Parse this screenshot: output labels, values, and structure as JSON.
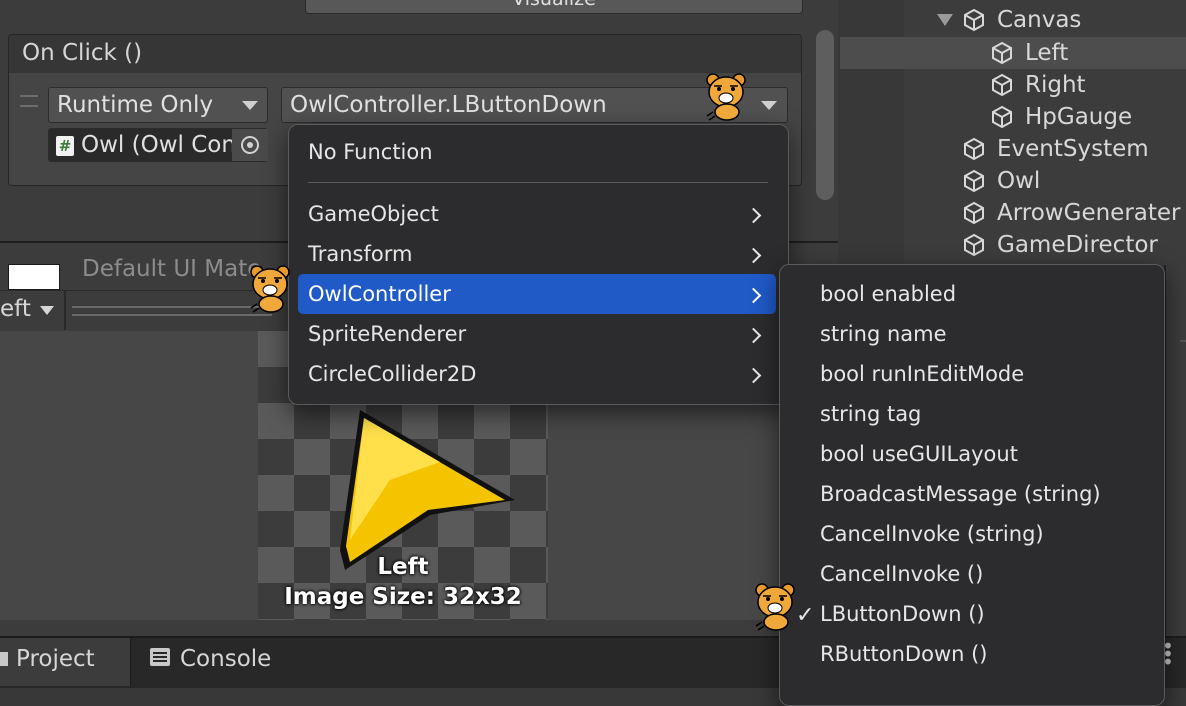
{
  "inspector": {
    "visualize_label": "Visualize",
    "onclick": {
      "title": "On Click ()",
      "runtime_dropdown": "Runtime Only",
      "function_dropdown": "OwlController.LButtonDown",
      "object_field": "Owl (Owl Con",
      "script_icon": "#"
    },
    "material_label": "Default UI Mate",
    "preview": {
      "dropdown_label": "eft",
      "sprite_name": "Left",
      "image_size": "Image Size: 32x32"
    }
  },
  "hierarchy": {
    "items": [
      {
        "label": "Canvas",
        "expanded": true
      },
      {
        "label": "Left",
        "selected": true
      },
      {
        "label": "Right"
      },
      {
        "label": "HpGauge"
      },
      {
        "label": "EventSystem"
      },
      {
        "label": "Owl"
      },
      {
        "label": "ArrowGenerater"
      },
      {
        "label": "GameDirector"
      }
    ]
  },
  "function_menu": {
    "no_function": "No Function",
    "components": [
      "GameObject",
      "Transform",
      "OwlController",
      "SpriteRenderer",
      "CircleCollider2D"
    ],
    "highlighted": "OwlController"
  },
  "submenu": {
    "items": [
      "bool enabled",
      "string name",
      "bool runInEditMode",
      "string tag",
      "bool useGUILayout",
      "BroadcastMessage (string)",
      "CancelInvoke (string)",
      "CancelInvoke ()",
      "LButtonDown ()",
      "RButtonDown ()"
    ],
    "checked": "LButtonDown ()",
    "checkmark": "✓"
  },
  "bottom_tabs": {
    "project": "Project",
    "console": "Console"
  },
  "colors": {
    "highlight": "#1f5ac7",
    "sprite_yellow": "#f5c400"
  },
  "icons": [
    "cube-icon",
    "chevron-right-icon",
    "dropdown-arrow-icon",
    "object-picker-icon",
    "script-icon",
    "console-icon",
    "kakao-sticker"
  ]
}
